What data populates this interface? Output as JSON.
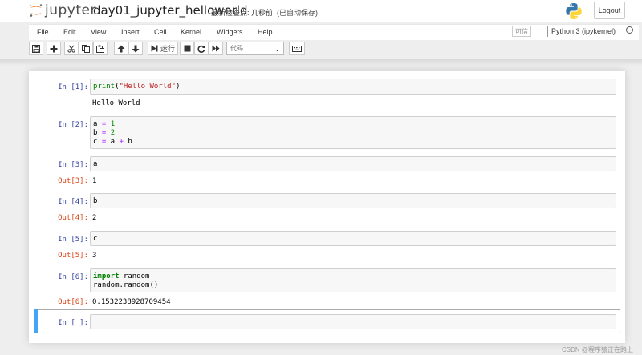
{
  "header": {
    "logo_text": "jupyter",
    "notebook_name": "day01_jupyter_helloworld",
    "checkpoint": "最新检查点: 几秒前",
    "autosave": "(已自动保存)",
    "logout_label": "Logout"
  },
  "menubar": {
    "items": [
      "File",
      "Edit",
      "View",
      "Insert",
      "Cell",
      "Kernel",
      "Widgets",
      "Help"
    ],
    "trusted": "可信",
    "kernel": "Python 3 (ipykernel)"
  },
  "toolbar": {
    "run_label": "运行",
    "cell_type": "代码"
  },
  "cells": [
    {
      "prompt": "In  [1]:",
      "code": "print(\"Hello World\")",
      "output_prompt": "",
      "output": "Hello World"
    },
    {
      "prompt": "In  [2]:",
      "code": "a = 1\nb = 2\nc = a + b",
      "output_prompt": "",
      "output": ""
    },
    {
      "prompt": "In  [3]:",
      "code": "a",
      "output_prompt": "Out[3]:",
      "output": "1"
    },
    {
      "prompt": "In  [4]:",
      "code": "b",
      "output_prompt": "Out[4]:",
      "output": "2"
    },
    {
      "prompt": "In  [5]:",
      "code": "c",
      "output_prompt": "Out[5]:",
      "output": "3"
    },
    {
      "prompt": "In  [6]:",
      "code": "import random\nrandom.random()",
      "output_prompt": "Out[6]:",
      "output": "0.1532238928709454"
    },
    {
      "prompt": "In  [ ]:",
      "code": "",
      "output_prompt": "",
      "output": ""
    }
  ],
  "watermark": "CSDN @程序猿正在路上",
  "colors": {
    "accent_selected": "#42a5f5",
    "in_prompt": "#303f9f",
    "out_prompt": "#d84315",
    "code_keyword": "#008000",
    "code_string": "#ba2121"
  }
}
